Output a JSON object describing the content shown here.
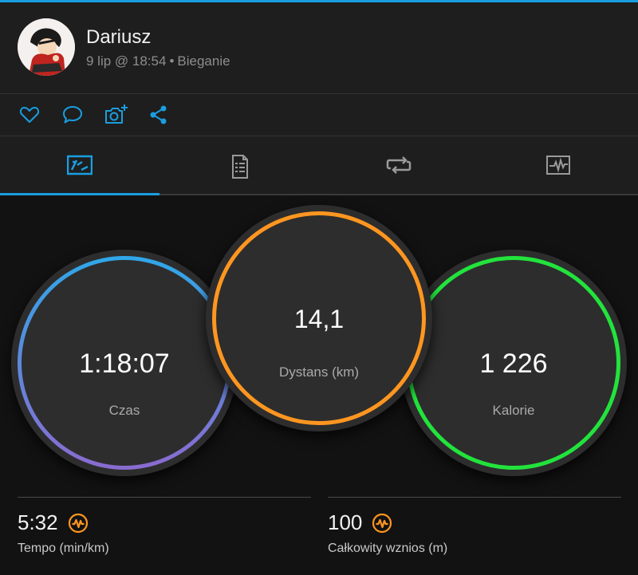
{
  "user": {
    "name": "Dariusz",
    "date": "9 lip @ 18:54",
    "separator": "•",
    "activity": "Bieganie"
  },
  "actions": [
    "heart-icon",
    "comment-icon",
    "camera-add-icon",
    "share-icon"
  ],
  "tabs": [
    "overview-icon",
    "details-icon",
    "laps-icon",
    "chart-icon"
  ],
  "active_tab": 0,
  "colors": {
    "accent": "#1a9ee0",
    "distance": "#ff9620",
    "calories": "#22e33c",
    "time_top": "#2fa7e8",
    "time_bottom": "#8a6bd0",
    "badge": "#ff9620"
  },
  "circles": {
    "time": {
      "value": "1:18:07",
      "label": "Czas"
    },
    "distance": {
      "value": "14,1",
      "label": "Dystans (km)"
    },
    "calories": {
      "value": "1 226",
      "label": "Kalorie"
    }
  },
  "stats": {
    "pace": {
      "value": "5:32",
      "label": "Tempo (min/km)"
    },
    "ascent": {
      "value": "100",
      "label": "Całkowity wznios (m)"
    }
  }
}
